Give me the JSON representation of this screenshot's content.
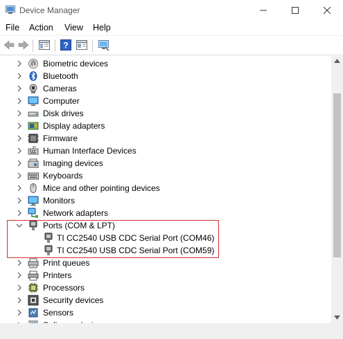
{
  "window": {
    "title": "Device Manager"
  },
  "menu": {
    "items": [
      "File",
      "Action",
      "View",
      "Help"
    ]
  },
  "tree": {
    "items": [
      {
        "label": "Biometric devices",
        "icon": "fingerprint-icon"
      },
      {
        "label": "Bluetooth",
        "icon": "bluetooth-icon"
      },
      {
        "label": "Cameras",
        "icon": "camera-icon"
      },
      {
        "label": "Computer",
        "icon": "computer-icon"
      },
      {
        "label": "Disk drives",
        "icon": "disk-drive-icon"
      },
      {
        "label": "Display adapters",
        "icon": "display-adapter-icon"
      },
      {
        "label": "Firmware",
        "icon": "firmware-icon"
      },
      {
        "label": "Human Interface Devices",
        "icon": "hid-icon"
      },
      {
        "label": "Imaging devices",
        "icon": "imaging-icon"
      },
      {
        "label": "Keyboards",
        "icon": "keyboard-icon"
      },
      {
        "label": "Mice and other pointing devices",
        "icon": "mouse-icon"
      },
      {
        "label": "Monitors",
        "icon": "monitor-icon"
      },
      {
        "label": "Network adapters",
        "icon": "network-adapter-icon"
      },
      {
        "label": "Ports (COM & LPT)",
        "icon": "port-icon",
        "expanded": true
      },
      {
        "label": "TI CC2540 USB CDC Serial Port (COM46)",
        "icon": "port-icon",
        "child": true
      },
      {
        "label": "TI CC2540 USB CDC Serial Port (COM59)",
        "icon": "port-icon",
        "child": true
      },
      {
        "label": "Print queues",
        "icon": "print-queue-icon"
      },
      {
        "label": "Printers",
        "icon": "printer-icon"
      },
      {
        "label": "Processors",
        "icon": "processor-icon"
      },
      {
        "label": "Security devices",
        "icon": "security-icon"
      },
      {
        "label": "Sensors",
        "icon": "sensor-icon"
      },
      {
        "label": "Software devices",
        "icon": "software-device-icon"
      }
    ]
  },
  "colors": {
    "highlight_border": "#d32f2f"
  }
}
